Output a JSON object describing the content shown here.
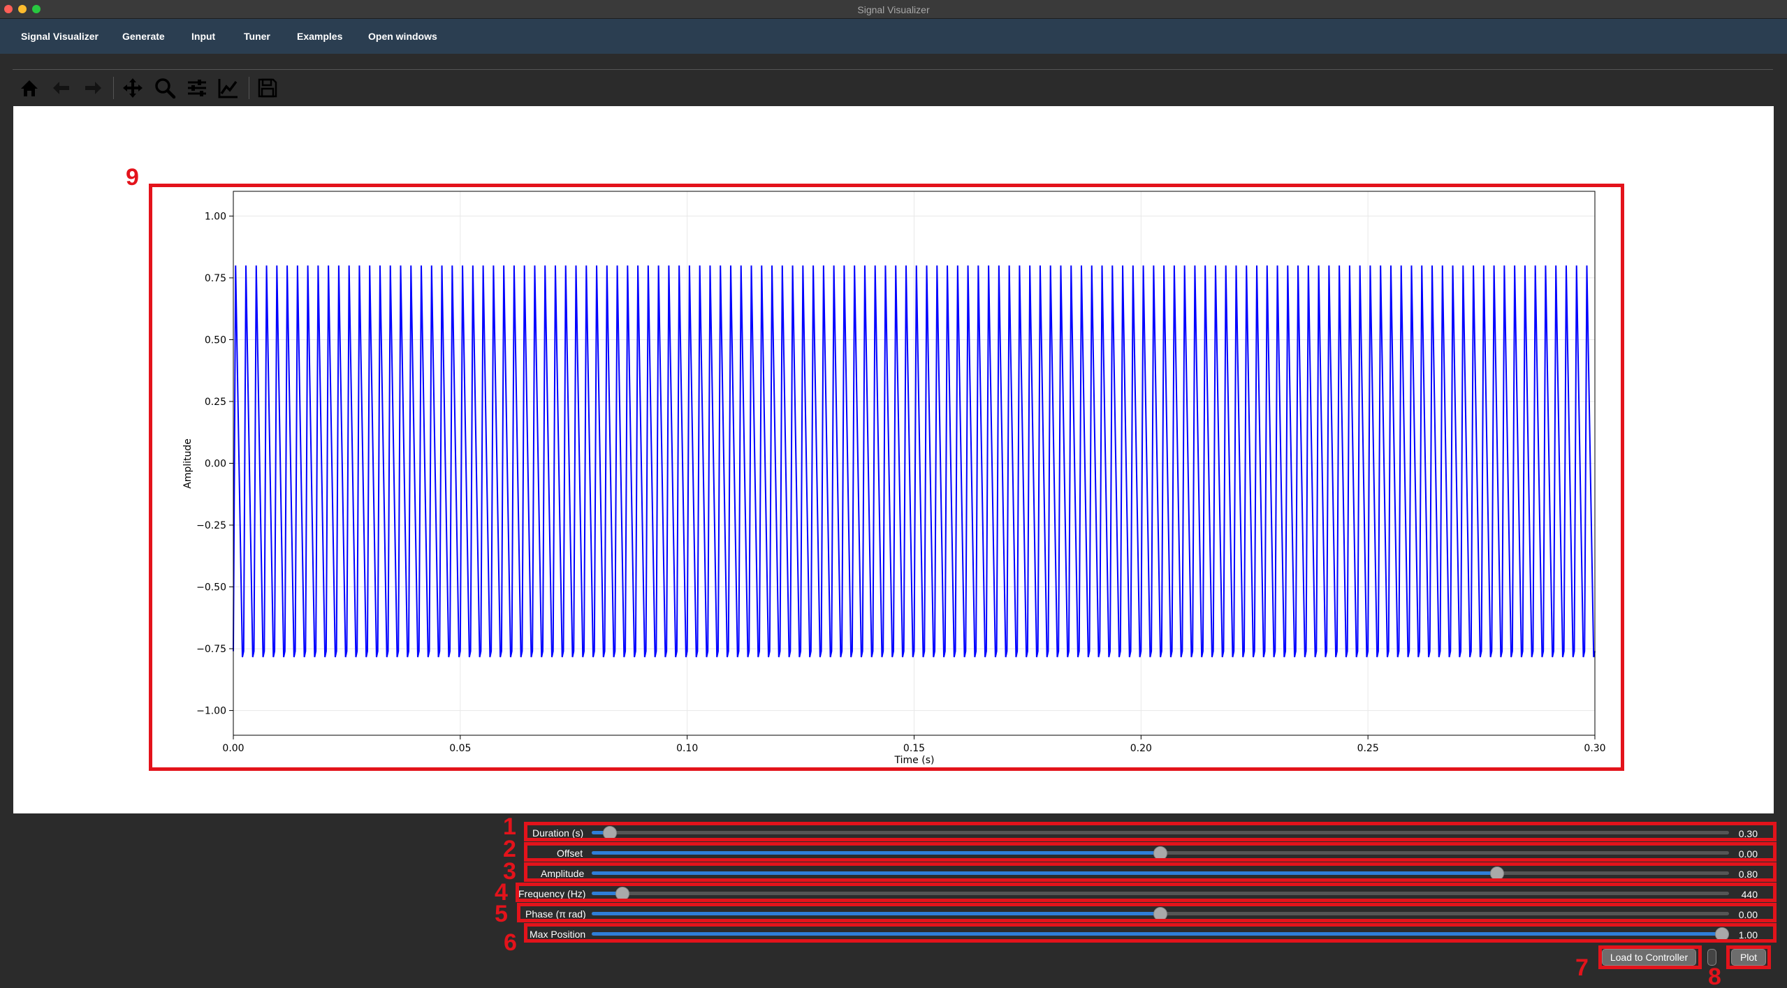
{
  "window": {
    "title": "Signal Visualizer"
  },
  "menu": [
    {
      "label": "Signal Visualizer"
    },
    {
      "label": "Generate"
    },
    {
      "label": "Input"
    },
    {
      "label": "Tuner"
    },
    {
      "label": "Examples"
    },
    {
      "label": "Open windows"
    }
  ],
  "toolbar": {
    "buttons": [
      "home-icon",
      "back-arrow-icon",
      "forward-arrow-icon",
      "pan-move-icon",
      "zoom-magnifier-icon",
      "configure-subplots-icon",
      "edit-axes-icon",
      "save-disk-icon"
    ]
  },
  "chart_data": {
    "type": "line",
    "title": "",
    "xlabel": "Time (s)",
    "ylabel": "Amplitude",
    "xlim": [
      0.0,
      0.3
    ],
    "ylim": [
      -1.1,
      1.1
    ],
    "xticks": [
      "0.00",
      "0.05",
      "0.10",
      "0.15",
      "0.20",
      "0.25",
      "0.30"
    ],
    "yticks": [
      "1.00",
      "0.75",
      "0.50",
      "0.25",
      "0.00",
      "−0.25",
      "−0.50",
      "−0.75",
      "−1.00"
    ],
    "grid": true,
    "series": [
      {
        "color": "#0000ff",
        "waveform": "sawtooth",
        "amplitude": 0.8,
        "offset": 0.0,
        "frequency_hz": 440,
        "phase_pi_rad": 0.0,
        "duration_s": 0.3
      }
    ]
  },
  "controls": [
    {
      "label": "Duration (s)",
      "value": "0.30",
      "fraction": 0.016
    },
    {
      "label": "Offset",
      "value": "0.00",
      "fraction": 0.5
    },
    {
      "label": "Amplitude",
      "value": "0.80",
      "fraction": 0.796
    },
    {
      "label": "Frequency (Hz)",
      "value": "440",
      "fraction": 0.027
    },
    {
      "label": "Phase (π rad)",
      "value": "0.00",
      "fraction": 0.5
    },
    {
      "label": "Max Position",
      "value": "1.00",
      "fraction": 0.994
    }
  ],
  "buttons": {
    "load_to_controller": "Load to Controller",
    "plot": "Plot"
  },
  "annotations": {
    "accent_color": "#e3131b",
    "labels": [
      "1",
      "2",
      "3",
      "4",
      "5",
      "6",
      "7",
      "8",
      "9"
    ]
  }
}
